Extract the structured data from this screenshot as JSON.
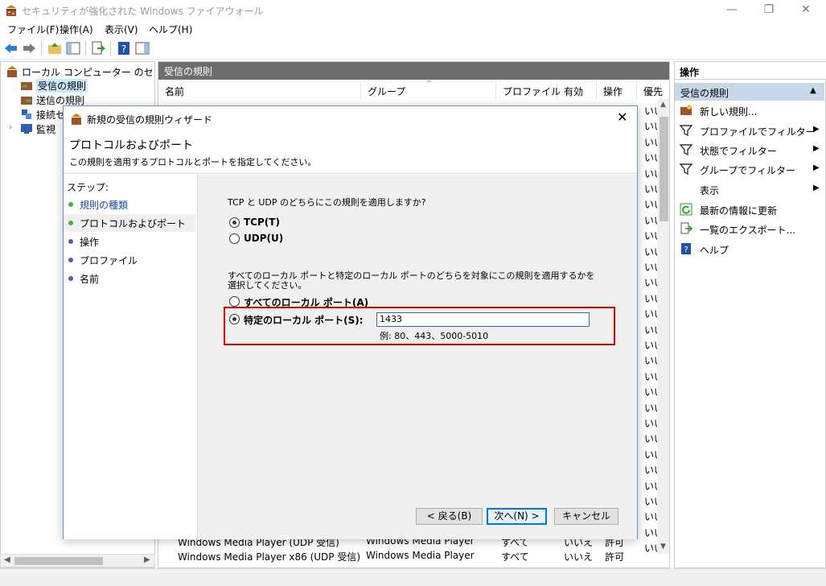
{
  "window": {
    "title": "セキュリティが強化された Windows ファイアウォール",
    "min_icon": "minimize-icon",
    "restore_icon": "restore-icon",
    "close_icon": "close-icon",
    "min_glyph": "—",
    "restore_glyph": "❐",
    "close_glyph": "✕"
  },
  "menu": [
    "ファイル(F)",
    "操作(A)",
    "表示(V)",
    "ヘルプ(H)"
  ],
  "tree": {
    "root": "ローカル コンピューター のセキュリティ",
    "items": [
      "受信の規則",
      "送信の規則",
      "接続セ",
      "監視"
    ]
  },
  "center": {
    "header": "受信の規則",
    "columns": [
      "名前",
      "グループ",
      "プロファイル",
      "有効",
      "操作",
      "優先"
    ],
    "cell_value": "いい",
    "bottom_rows": [
      [
        "Windows Media Player (UDP 受信)",
        "Windows Media Player",
        "すべて",
        "いいえ",
        "許可"
      ],
      [
        "Windows Media Player x86 (UDP 受信)",
        "Windows Media Player",
        "すべて",
        "いいえ",
        "許可"
      ]
    ]
  },
  "actions": {
    "header": "操作",
    "section": "受信の規則",
    "items": [
      {
        "label": "新しい規則...",
        "icon": "new-rule-icon",
        "arrow": false
      },
      {
        "label": "プロファイルでフィルター",
        "icon": "filter-icon",
        "arrow": true
      },
      {
        "label": "状態でフィルター",
        "icon": "filter-icon",
        "arrow": true
      },
      {
        "label": "グループでフィルター",
        "icon": "filter-icon",
        "arrow": true
      },
      {
        "label": "表示",
        "icon": "",
        "arrow": true
      },
      {
        "label": "最新の情報に更新",
        "icon": "refresh-icon",
        "arrow": false
      },
      {
        "label": "一覧のエクスポート...",
        "icon": "export-icon",
        "arrow": false
      },
      {
        "label": "ヘルプ",
        "icon": "help-icon",
        "arrow": false
      }
    ]
  },
  "dialog": {
    "title": "新規の受信の規則ウィザード",
    "heading": "プロトコルおよびポート",
    "subheading": "この規則を適用するプロトコルとポートを指定してください。",
    "steps_title": "ステップ:",
    "steps": [
      "規則の種類",
      "プロトコルおよびポート",
      "操作",
      "プロファイル",
      "名前"
    ],
    "active_step_index": 1,
    "question_protocol": "TCP と UDP のどちらにこの規則を適用しますか?",
    "protocol_tcp": "TCP(T)",
    "protocol_udp": "UDP(U)",
    "question_port": "すべてのローカル ポートと特定のローカル ポートのどちらを対象にこの規則を適用するかを選択してください。",
    "port_all": "すべてのローカル ポート(A)",
    "port_specific": "特定のローカル ポート(S):",
    "port_value": "1433",
    "port_example": "例: 80、443、5000-5010",
    "btn_back": "< 戻る(B)",
    "btn_next": "次へ(N) >",
    "btn_cancel": "キャンセル"
  },
  "colors": {
    "step_dot": "#3cb43c",
    "step_dot_inactive": "#5a5ab4",
    "highlight_box": "#e00000",
    "accent": "#0078d7"
  }
}
